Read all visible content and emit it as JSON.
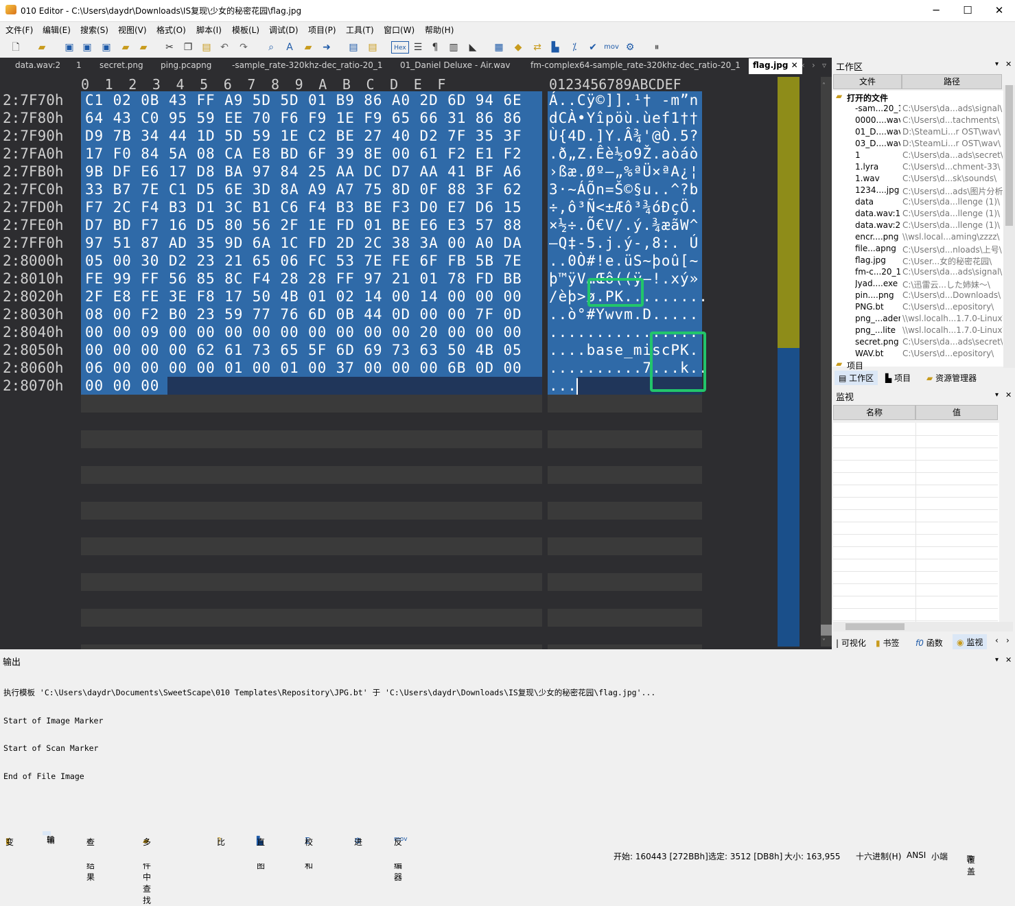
{
  "window": {
    "title": "010 Editor - C:\\Users\\daydr\\Downloads\\IS复现\\少女的秘密花园\\flag.jpg"
  },
  "menu": [
    "文件(F)",
    "编辑(E)",
    "搜索(S)",
    "视图(V)",
    "格式(O)",
    "脚本(I)",
    "模板(L)",
    "调试(D)",
    "项目(P)",
    "工具(T)",
    "窗口(W)",
    "帮助(H)"
  ],
  "toolbar": {
    "hex_label": "Hex",
    "mov_label": "mov"
  },
  "tabs": [
    "data.wav:2",
    "1",
    "secret.png",
    "ping.pcapng",
    "-sample_rate-320khz-dec_ratio-20_1",
    "01_Daniel Deluxe - Air.wav",
    "fm-complex64-sample_rate-320khz-dec_ratio-20_1",
    "flag.jpg"
  ],
  "hex": {
    "col_header": "0  1  2  3  4  5  6  7  8  9  A  B  C  D  E  F",
    "ascii_header": "0123456789ABCDEF",
    "addresses": [
      "2:7F70h",
      "2:7F80h",
      "2:7F90h",
      "2:7FA0h",
      "2:7FB0h",
      "2:7FC0h",
      "2:7FD0h",
      "2:7FE0h",
      "2:7FF0h",
      "2:8000h",
      "2:8010h",
      "2:8020h",
      "2:8030h",
      "2:8040h",
      "2:8050h",
      "2:8060h",
      "2:8070h"
    ],
    "rows": [
      "C1 02 0B 43 FF A9 5D 5D 01 B9 86 A0 2D 6D 94 6E",
      "64 43 C0 95 59 EE 70 F6 F9 1E F9 65 66 31 86 86",
      "D9 7B 34 44 1D 5D 59 1E C2 BE 27 40 D2 7F 35 3F",
      "17 F0 84 5A 08 CA E8 BD 6F 39 8E 00 61 F2 E1 F2",
      "9B DF E6 17 D8 BA 97 84 25 AA DC D7 AA 41 BF A6",
      "33 B7 7E C1 D5 6E 3D 8A A9 A7 75 8D 0F 88 3F 62",
      "F7 2C F4 B3 D1 3C B1 C6 F4 B3 BE F3 D0 E7 D6 15",
      "D7 BD F7 16 D5 80 56 2F 1E FD 01 BE E6 E3 57 88",
      "97 51 87 AD 35 9D 6A 1C FD 2D 2C 38 3A 00 A0 DA",
      "05 00 30 D2 23 21 65 06 FC 53 7E FE 6F FB 5B 7E",
      "FE 99 FF 56 85 8C F4 28 28 FF 97 21 01 78 FD BB",
      "2F E8 FE 3E F8 17 50 4B 01 02 14 00 14 00 00 00",
      "08 00 F2 B0 23 59 77 76 6D 0B 44 0D 00 00 7F 0D",
      "00 00 09 00 00 00 00 00 00 00 00 00 20 00 00 00",
      "00 00 00 00 62 61 73 65 5F 6D 69 73 63 50 4B 05",
      "06 00 00 00 00 01 00 01 00 37 00 00 00 6B 0D 00",
      "00 00 00"
    ],
    "ascii": [
      "Á..Cÿ©]].¹† -m”n",
      "dCÀ•Yîpöù.ùef1††",
      "Ù{4D.]Y.Â¾'@Ò.5?",
      ".ð„Z.Êè½o9Ž.aòáò",
      "›ßæ.Øº—„%ªÜ×ªA¿¦",
      "3·~ÁÕn=Š©§u..^?b",
      "÷,ô³Ñ<±Æô³¾óÐçÖ.",
      "×½÷.Õ€V/.ý.¾æãW^",
      "—Q‡-5.j.ý-,8:. Ú",
      "..0Ò#!e.üS~þoû[~",
      "þ™ÿV…Œô((ÿ—!.xý»",
      "/èþ>ø.PK.........",
      "..ò°#Ywvm.D.....",
      "................",
      "....base_miscPK.",
      "..........7...k..",
      "..."
    ]
  },
  "right_panel": {
    "title": "工作区",
    "col_file": "文件",
    "col_path": "路径",
    "open_files_label": "打开的文件",
    "files": [
      {
        "name": "-sam...20_1",
        "path": "C:\\Users\\da...ads\\signal\\"
      },
      {
        "name": "0000....wav",
        "path": "C:\\Users\\d...tachments\\"
      },
      {
        "name": "01_D....wav",
        "path": "D:\\SteamLi...r OST\\wav\\"
      },
      {
        "name": "03_D....wav",
        "path": "D:\\SteamLi...r OST\\wav\\"
      },
      {
        "name": "1",
        "path": "C:\\Users\\da...ads\\secret\\"
      },
      {
        "name": "1.lyra",
        "path": "C:\\Users\\d...chment-33\\"
      },
      {
        "name": "1.wav",
        "path": "C:\\Users\\d...sk\\sounds\\"
      },
      {
        "name": "1234....jpg",
        "path": "C:\\Users\\d...ads\\图片分析\\"
      },
      {
        "name": "data",
        "path": "C:\\Users\\da...llenge (1)\\"
      },
      {
        "name": "data.wav:1",
        "path": "C:\\Users\\da...llenge (1)\\"
      },
      {
        "name": "data.wav:2",
        "path": "C:\\Users\\da...llenge (1)\\"
      },
      {
        "name": "encr....png",
        "path": "\\\\wsl.local...aming\\zzzz\\"
      },
      {
        "name": "file...apng",
        "path": "C:\\Users\\d...nloads\\上号\\"
      },
      {
        "name": "flag.jpg",
        "path": "C:\\User...女的秘密花园\\"
      },
      {
        "name": "fm-c...20_1",
        "path": "C:\\Users\\da...ads\\signal\\"
      },
      {
        "name": "Jyad....exe",
        "path": "C:\\迅雷云...した姉妹～\\"
      },
      {
        "name": "pin....png",
        "path": "C:\\Users\\d...Downloads\\"
      },
      {
        "name": "PNG.bt",
        "path": "C:\\Users\\d...epository\\"
      },
      {
        "name": "png_...ader",
        "path": "\\\\wsl.localh...1.7.0-Linux\\"
      },
      {
        "name": "png_...lite",
        "path": "\\\\wsl.localh...1.7.0-Linux\\"
      },
      {
        "name": "secret.png",
        "path": "C:\\Users\\da...ads\\secret\\"
      },
      {
        "name": "WAV.bt",
        "path": "C:\\Users\\d...epository\\"
      }
    ],
    "project_label": "项目",
    "tabs": [
      "工作区",
      "项目",
      "资源管理器"
    ],
    "watch_title": "监视",
    "watch_col_name": "名称",
    "watch_col_value": "值",
    "bottom_tabs": [
      "可视化",
      "书签",
      "函数",
      "监视"
    ]
  },
  "output": {
    "title": "输出",
    "lines": [
      "执行模板 'C:\\Users\\daydr\\Documents\\SweetScape\\010 Templates\\Repository\\JPG.bt' 于 'C:\\Users\\daydr\\Downloads\\IS复现\\少女的秘密花园\\flag.jpg'...",
      "Start of Image Marker",
      "Start of Scan Marker",
      "End of File Image"
    ]
  },
  "bottom_tabs": [
    "变量",
    "输出",
    "查找结果",
    "多文件中查找",
    "比较",
    "直方图",
    "校验和",
    "进程",
    "反汇编器"
  ],
  "status": {
    "start": "开始: 160443 [272BBh]",
    "selection": "选定: 3512 [DB8h]",
    "size": "大小: 163,955",
    "mode": "十六进制(H)",
    "encoding": "ANSI",
    "endian": "小端",
    "overwrite": "覆盖"
  },
  "colors": {
    "selection": "#2f6aa8",
    "editor_bg": "#2d2d30",
    "highlight": "#22c56b"
  }
}
